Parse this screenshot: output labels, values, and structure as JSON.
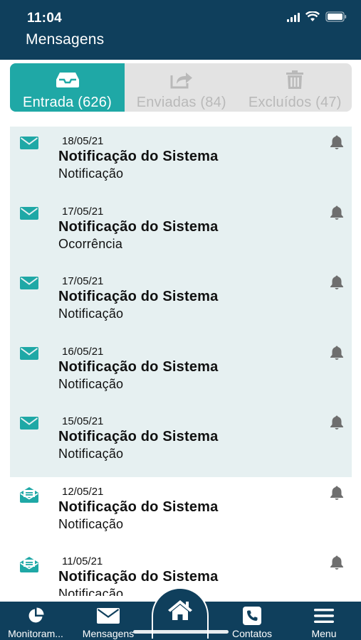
{
  "status_bar": {
    "time": "11:04"
  },
  "header": {
    "title": "Mensagens"
  },
  "tabs": [
    {
      "label": "Entrada (626)",
      "icon": "inbox-icon",
      "active": true
    },
    {
      "label": "Enviadas (84)",
      "icon": "share-icon",
      "active": false
    },
    {
      "label": "Excluídos (47)",
      "icon": "trash-icon",
      "active": false
    }
  ],
  "messages": [
    {
      "date": "18/05/21",
      "title": "Notificação do Sistema",
      "subtitle": "Notificação",
      "read": false,
      "icon": "envelope-icon"
    },
    {
      "date": "17/05/21",
      "title": "Notificação do Sistema",
      "subtitle": "Ocorrência",
      "read": false,
      "icon": "envelope-icon"
    },
    {
      "date": "17/05/21",
      "title": "Notificação do Sistema",
      "subtitle": "Notificação",
      "read": false,
      "icon": "envelope-icon"
    },
    {
      "date": "16/05/21",
      "title": "Notificação do Sistema",
      "subtitle": "Notificação",
      "read": false,
      "icon": "envelope-icon"
    },
    {
      "date": "15/05/21",
      "title": "Notificação do Sistema",
      "subtitle": "Notificação",
      "read": false,
      "icon": "envelope-icon"
    },
    {
      "date": "12/05/21",
      "title": "Notificação do Sistema",
      "subtitle": "Notificação",
      "read": true,
      "icon": "envelope-open-icon"
    },
    {
      "date": "11/05/21",
      "title": "Notificação do Sistema",
      "subtitle": "Notificação",
      "read": true,
      "icon": "envelope-open-icon"
    }
  ],
  "bottom_nav": {
    "monitor_label": "Monitoram...",
    "messages_label": "Mensagens",
    "contacts_label": "Contatos",
    "menu_label": "Menu"
  },
  "colors": {
    "header_bg": "#0f3f5c",
    "accent": "#1fa8a6",
    "unread_bg": "#e6f0f1",
    "tab_inactive_bg": "#e3e3e3",
    "tab_inactive_text": "#b9b9b9",
    "bell": "#6e6e6e"
  }
}
